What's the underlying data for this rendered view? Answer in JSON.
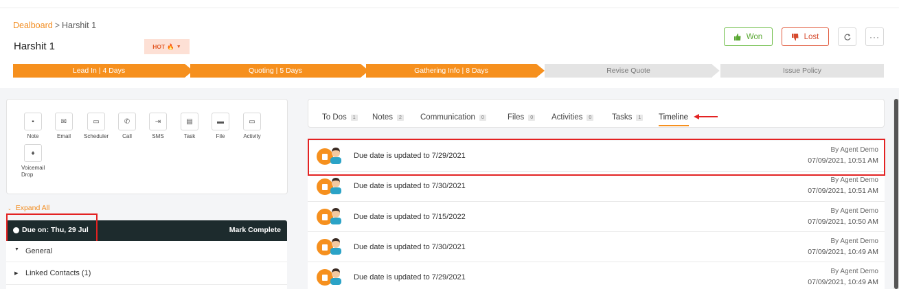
{
  "breadcrumb": {
    "parent": "Dealboard",
    "separator": ">",
    "current": "Harshit 1"
  },
  "deal": {
    "title": "Harshit 1",
    "badge": "HOT"
  },
  "actions_header": {
    "won": "Won",
    "lost": "Lost"
  },
  "pipeline": {
    "stages": [
      {
        "label": "Lead In | 4 Days",
        "state": "complete"
      },
      {
        "label": "Quoting | 5 Days",
        "state": "complete"
      },
      {
        "label": "Gathering Info | 8 Days",
        "state": "complete"
      },
      {
        "label": "Revise Quote",
        "state": "pending"
      },
      {
        "label": "Issue Policy",
        "state": "pending"
      }
    ]
  },
  "quick_actions": [
    {
      "label": "Note",
      "icon": "note-icon"
    },
    {
      "label": "Email",
      "icon": "email-icon"
    },
    {
      "label": "Scheduler",
      "icon": "calendar-icon"
    },
    {
      "label": "Call",
      "icon": "phone-icon"
    },
    {
      "label": "SMS",
      "icon": "sms-icon"
    },
    {
      "label": "Task",
      "icon": "task-icon"
    },
    {
      "label": "File",
      "icon": "folder-icon"
    },
    {
      "label": "Activity",
      "icon": "calendar-icon"
    },
    {
      "label": "Voicemail Drop",
      "icon": "mic-icon"
    }
  ],
  "left": {
    "expand_all": "Expand All",
    "due_on": "Due on: Thu, 29 Jul",
    "mark_complete": "Mark Complete",
    "sections": [
      "General",
      "Linked Contacts (1)"
    ]
  },
  "tabs": [
    {
      "label": "To Dos",
      "count": "1"
    },
    {
      "label": "Notes",
      "count": "2"
    },
    {
      "label": "Communication",
      "count": "0"
    },
    {
      "label": "Files",
      "count": "0"
    },
    {
      "label": "Activities",
      "count": "0"
    },
    {
      "label": "Tasks",
      "count": "1"
    },
    {
      "label": "Timeline",
      "count": ""
    }
  ],
  "active_tab": "Timeline",
  "timeline": [
    {
      "text": "Due date is updated to 7/29/2021",
      "by": "By Agent Demo",
      "date": "07/09/2021, 10:51 AM"
    },
    {
      "text": "Due date is updated to 7/30/2021",
      "by": "By Agent Demo",
      "date": "07/09/2021, 10:51 AM"
    },
    {
      "text": "Due date is updated to 7/15/2022",
      "by": "By Agent Demo",
      "date": "07/09/2021, 10:50 AM"
    },
    {
      "text": "Due date is updated to 7/30/2021",
      "by": "By Agent Demo",
      "date": "07/09/2021, 10:49 AM"
    },
    {
      "text": "Due date is updated to 7/29/2021",
      "by": "By Agent Demo",
      "date": "07/09/2021, 10:49 AM"
    }
  ],
  "colors": {
    "accent": "#f6901e",
    "highlight": "#e32222",
    "won": "#5aa833",
    "lost": "#d64a2d",
    "due_bar": "#1d2b2d"
  }
}
